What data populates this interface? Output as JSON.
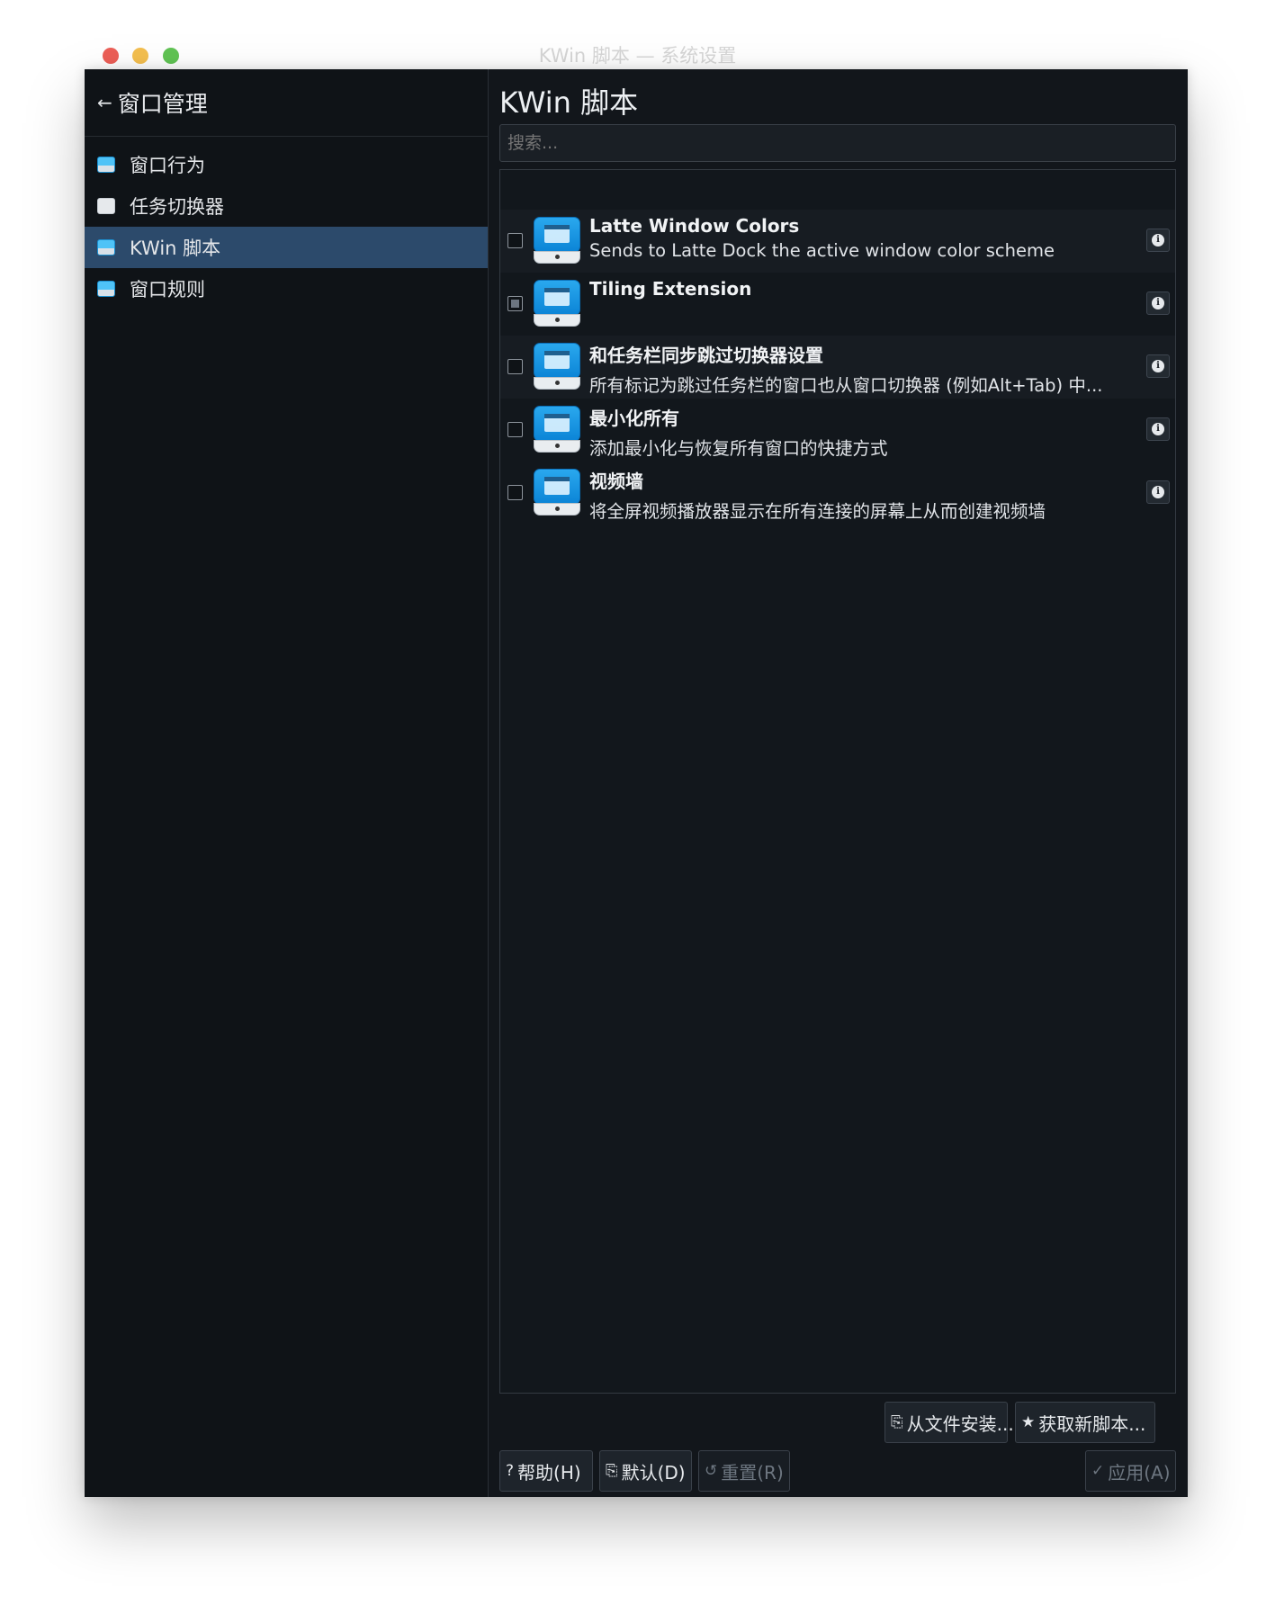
{
  "window": {
    "title": "KWin 脚本 — 系统设置"
  },
  "sidebar": {
    "header": "窗口管理",
    "items": [
      {
        "label": "窗口行为",
        "icon": "window-icon"
      },
      {
        "label": "任务切换器",
        "icon": "box-icon"
      },
      {
        "label": "KWin 脚本",
        "icon": "window-icon",
        "active": true
      },
      {
        "label": "窗口规则",
        "icon": "window-icon"
      }
    ]
  },
  "main": {
    "title": "KWin 脚本",
    "search_placeholder": "搜索...",
    "scripts": [
      {
        "title": "Latte Window Colors",
        "desc": "Sends to Latte Dock the active window color scheme",
        "checked": false
      },
      {
        "title": "Tiling Extension",
        "desc": "",
        "checked": "partial"
      },
      {
        "title": "和任务栏同步跳过切换器设置",
        "desc": "所有标记为跳过任务栏的窗口也从窗口切换器 (例如Alt+Tab) 中...",
        "checked": false
      },
      {
        "title": "最小化所有",
        "desc": "添加最小化与恢复所有窗口的快捷方式",
        "checked": false
      },
      {
        "title": "视频墙",
        "desc": "将全屏视频播放器显示在所有连接的屏幕上从而创建视频墙",
        "checked": false
      }
    ]
  },
  "buttons": {
    "install": "从文件安装...",
    "get_new": "获取新脚本...",
    "help": "帮助(H)",
    "default": "默认(D)",
    "reset": "重置(R)",
    "apply": "应用(A)"
  },
  "colors": {
    "accent_selection": "#2c4a6b",
    "window_bg": "#12161b"
  }
}
